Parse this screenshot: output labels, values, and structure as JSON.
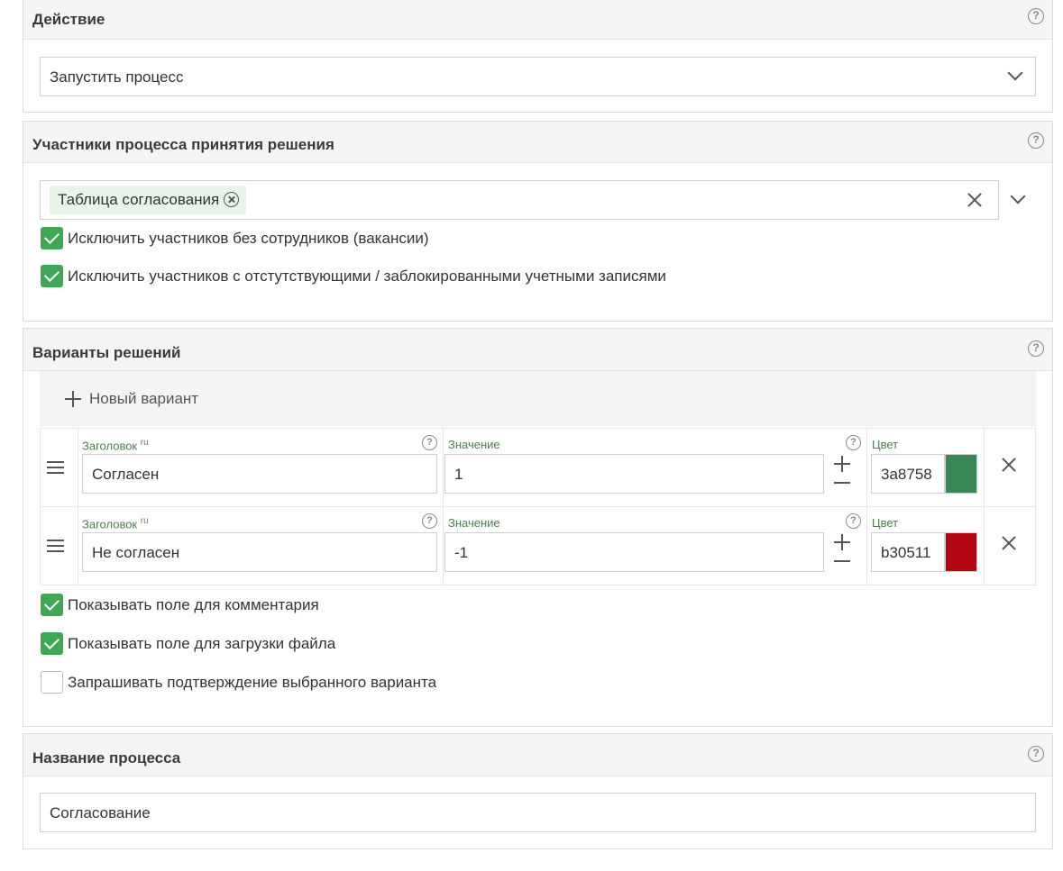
{
  "action": {
    "title": "Действие",
    "selected": "Запустить процесс"
  },
  "participants": {
    "title": "Участники процесса принятия решения",
    "tag": "Таблица согласования",
    "checkboxes": [
      {
        "label": "Исключить участников без сотрудников (вакансии)",
        "checked": true
      },
      {
        "label": "Исключить участников с отстутствующими / заблокированными учетными записями",
        "checked": true
      }
    ]
  },
  "variants": {
    "title": "Варианты решений",
    "new_variant": "Новый вариант",
    "rows": [
      {
        "title_label": "Заголовок",
        "lang": "ru",
        "title_value": "Согласен",
        "value_label": "Значение",
        "value": "1",
        "color_label": "Цвет",
        "color_hex": "3a8758",
        "color": "#3a8758"
      },
      {
        "title_label": "Заголовок",
        "lang": "ru",
        "title_value": "Не согласен",
        "value_label": "Значение",
        "value": "-1",
        "color_label": "Цвет",
        "color_hex": "b30511",
        "color": "#b30511"
      }
    ],
    "checkboxes": [
      {
        "label": "Показывать поле для комментария",
        "checked": true
      },
      {
        "label": "Показывать поле для загрузки файла",
        "checked": true
      },
      {
        "label": "Запрашивать подтверждение выбранного варианта",
        "checked": false
      }
    ]
  },
  "process_name": {
    "title": "Название процесса",
    "value": "Согласование"
  },
  "colors": {
    "checkbox_on": "#3fa857",
    "tag_bg": "#e8f4ea",
    "panel_head_bg": "#f5f5f5"
  }
}
